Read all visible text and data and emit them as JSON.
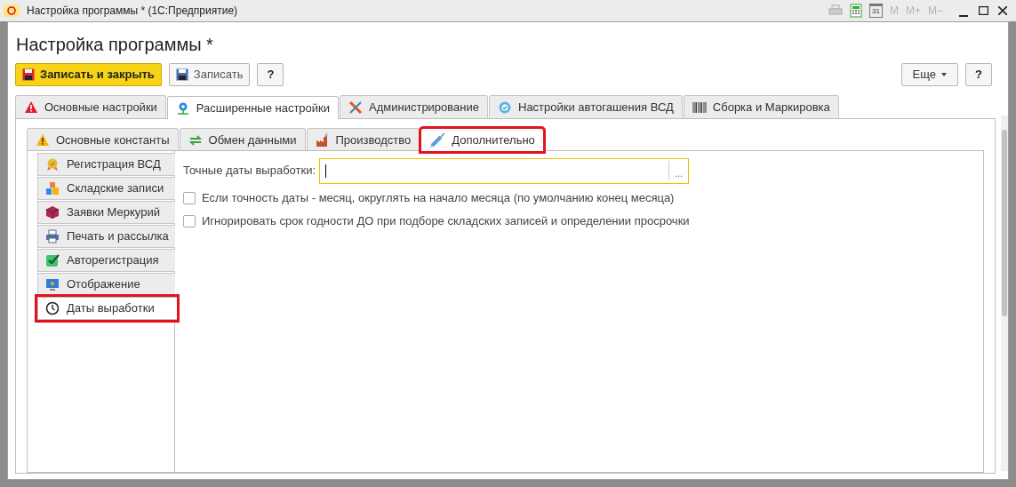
{
  "window": {
    "title": "Настройка программы * (1С:Предприятие)",
    "calendar_day": "31",
    "memory_buttons": [
      {
        "label": "M",
        "disabled": true
      },
      {
        "label": "M+",
        "disabled": true
      },
      {
        "label": "M−",
        "disabled": true
      }
    ]
  },
  "heading": "Настройка программы *",
  "toolbar": {
    "buttons": [
      {
        "kind": "primary",
        "label": "Записать и закрыть"
      },
      {
        "kind": "save",
        "label": "Записать"
      },
      {
        "kind": "help",
        "label": "?"
      }
    ],
    "right_buttons": [
      {
        "kind": "menu",
        "label": "Еще"
      },
      {
        "kind": "help",
        "label": "?"
      }
    ]
  },
  "tabs": [
    {
      "label": "Основные настройки",
      "kind": "warning",
      "selected": false,
      "highlighted": false
    },
    {
      "label": "Расширенные настройки",
      "kind": "gear",
      "selected": true,
      "highlighted": false
    },
    {
      "label": "Администрирование",
      "kind": "tools",
      "selected": false,
      "highlighted": false
    },
    {
      "label": "Настройки автогашения ВСД",
      "kind": "badge",
      "selected": false,
      "highlighted": false
    },
    {
      "label": "Сборка и Маркировка",
      "kind": "barcode",
      "selected": false,
      "highlighted": false
    }
  ],
  "subtabs": [
    {
      "label": "Основные константы",
      "kind": "warn",
      "selected": false,
      "highlighted": false
    },
    {
      "label": "Обмен данными",
      "kind": "sync",
      "selected": false,
      "highlighted": false
    },
    {
      "label": "Производство",
      "kind": "factory",
      "selected": false,
      "highlighted": false
    },
    {
      "label": "Дополнительно",
      "kind": "syringe",
      "selected": true,
      "highlighted": true
    }
  ],
  "sidebar": {
    "items": [
      {
        "label": "Регистрация ВСД",
        "kind": "medal",
        "selected": false,
        "highlighted": false
      },
      {
        "label": "Складские записи",
        "kind": "boxes",
        "selected": false,
        "highlighted": false
      },
      {
        "label": "Заявки Меркурий",
        "kind": "cube",
        "selected": false,
        "highlighted": false
      },
      {
        "label": "Печать и рассылка",
        "kind": "printer",
        "selected": false,
        "highlighted": false
      },
      {
        "label": "Авторегистрация",
        "kind": "check",
        "selected": false,
        "highlighted": false
      },
      {
        "label": "Отображение",
        "kind": "monitor",
        "selected": false,
        "highlighted": false
      },
      {
        "label": "Даты выработки",
        "kind": "clock",
        "selected": true,
        "highlighted": true
      }
    ]
  },
  "form": {
    "field": {
      "label": "Точные даты выработки:",
      "focused": true,
      "select_button": "..."
    },
    "checkboxes": [
      {
        "label": "Если точность даты - месяц, округлять на начало месяца (по умолчанию конец месяца)",
        "checked": false
      },
      {
        "label": "Игнорировать срок годности ДО при подборе складских записей и определении просрочки",
        "checked": false
      }
    ]
  }
}
